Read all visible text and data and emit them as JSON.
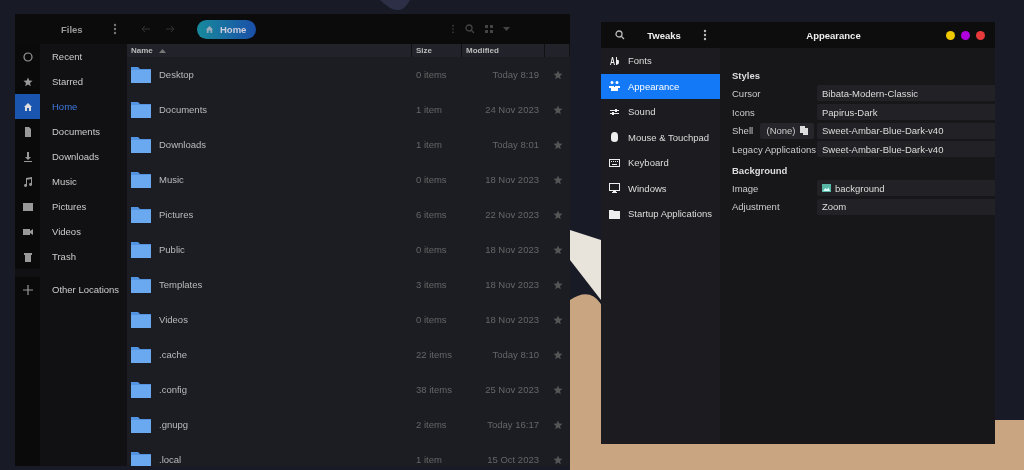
{
  "files": {
    "title": "Files",
    "path": "Home",
    "sidebar": [
      {
        "label": "Recent",
        "selected": false
      },
      {
        "label": "Starred",
        "selected": false
      },
      {
        "label": "Home",
        "selected": true
      },
      {
        "label": "Documents",
        "selected": false
      },
      {
        "label": "Downloads",
        "selected": false
      },
      {
        "label": "Music",
        "selected": false
      },
      {
        "label": "Pictures",
        "selected": false
      },
      {
        "label": "Videos",
        "selected": false
      },
      {
        "label": "Trash",
        "selected": false
      },
      {
        "label": "Other Locations",
        "selected": false
      }
    ],
    "columns": [
      "Name",
      "Size",
      "Modified"
    ],
    "rows": [
      {
        "name": "Desktop",
        "size": "0 items",
        "modified": "Today 8:19"
      },
      {
        "name": "Documents",
        "size": "1 item",
        "modified": "24 Nov 2023"
      },
      {
        "name": "Downloads",
        "size": "1 item",
        "modified": "Today 8:01"
      },
      {
        "name": "Music",
        "size": "0 items",
        "modified": "18 Nov 2023"
      },
      {
        "name": "Pictures",
        "size": "6 items",
        "modified": "22 Nov 2023"
      },
      {
        "name": "Public",
        "size": "0 items",
        "modified": "18 Nov 2023"
      },
      {
        "name": "Templates",
        "size": "3 items",
        "modified": "18 Nov 2023"
      },
      {
        "name": "Videos",
        "size": "0 items",
        "modified": "18 Nov 2023"
      },
      {
        "name": ".cache",
        "size": "22 items",
        "modified": "Today 8:10"
      },
      {
        "name": ".config",
        "size": "38 items",
        "modified": "25 Nov 2023"
      },
      {
        "name": ".gnupg",
        "size": "2 items",
        "modified": "Today 16:17"
      },
      {
        "name": ".local",
        "size": "1 item",
        "modified": "15 Oct 2023"
      }
    ]
  },
  "tweaks": {
    "title": "Tweaks",
    "page_title": "Appearance",
    "sidebar": [
      {
        "label": "Fonts",
        "selected": false
      },
      {
        "label": "Appearance",
        "selected": true
      },
      {
        "label": "Sound",
        "selected": false
      },
      {
        "label": "Mouse & Touchpad",
        "selected": false
      },
      {
        "label": "Keyboard",
        "selected": false
      },
      {
        "label": "Windows",
        "selected": false
      },
      {
        "label": "Startup Applications",
        "selected": false
      }
    ],
    "sections": [
      {
        "heading": "Styles",
        "rows": [
          {
            "kind": "choice",
            "label": "Cursor",
            "value": "Bibata-Modern-Classic"
          },
          {
            "kind": "choice",
            "label": "Icons",
            "value": "Papirus-Dark"
          },
          {
            "kind": "choice",
            "label": "Shell",
            "value": "Sweet-Ambar-Blue-Dark-v40",
            "reset": "(None)"
          },
          {
            "kind": "choice",
            "label": "Legacy Applications",
            "value": "Sweet-Ambar-Blue-Dark-v40"
          }
        ]
      },
      {
        "heading": "Background",
        "rows": [
          {
            "kind": "file",
            "label": "Image",
            "value": "background"
          },
          {
            "kind": "choice",
            "label": "Adjustment",
            "value": "Zoom"
          }
        ]
      }
    ]
  }
}
